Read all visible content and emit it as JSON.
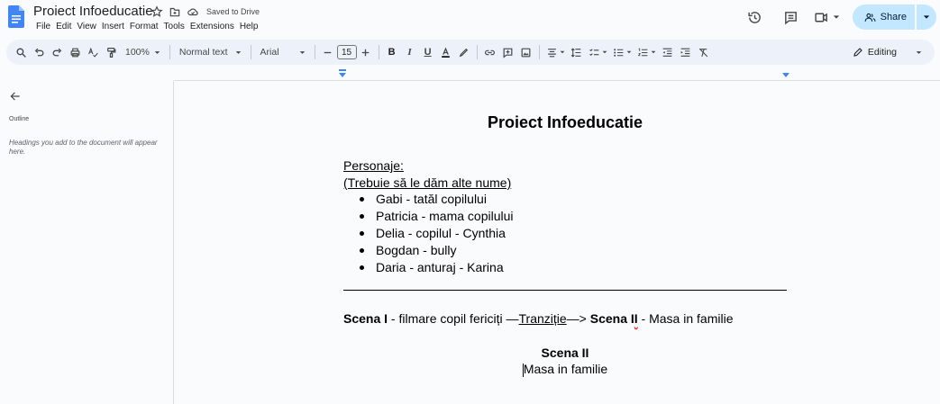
{
  "doc": {
    "title": "Proiect Infoeducatie",
    "saved_status": "Saved to Drive"
  },
  "menu": [
    "File",
    "Edit",
    "View",
    "Insert",
    "Format",
    "Tools",
    "Extensions",
    "Help"
  ],
  "header_right": {
    "share_label": "Share"
  },
  "toolbar": {
    "zoom": "100%",
    "style": "Normal text",
    "font": "Arial",
    "font_size": "15",
    "mode": "Editing"
  },
  "sidebar": {
    "outline_label": "Outline",
    "hint": "Headings you add to the document will appear here."
  },
  "content": {
    "heading": "Proiect Infoeducatie",
    "personaje_label": "Personaje:",
    "note": "(Trebuie să le dăm alte nume)",
    "characters": [
      "Gabi - tatăl copilului",
      "Patricia - mama copilului",
      "Delia - copilul - Cynthia",
      "Bogdan - bully",
      "Daria - anturaj - Karina"
    ],
    "scene_line": {
      "scene1": "Scena I",
      "scene1_desc": " - filmare copil fericiți —",
      "transition": "Tranziție",
      "arrow": "—> ",
      "scene2_prefix": "Scena I",
      "scene2_suffix": "I",
      "scene2_desc": " - Masa in familie"
    },
    "scene2_title": "Scena II",
    "scene2_subtitle": "Masa in familie"
  },
  "colors": {
    "accent": "#1a73e8",
    "share_bg": "#c2e7ff",
    "toolbar_bg": "#edf2fa",
    "docs_blue": "#4285f4"
  }
}
